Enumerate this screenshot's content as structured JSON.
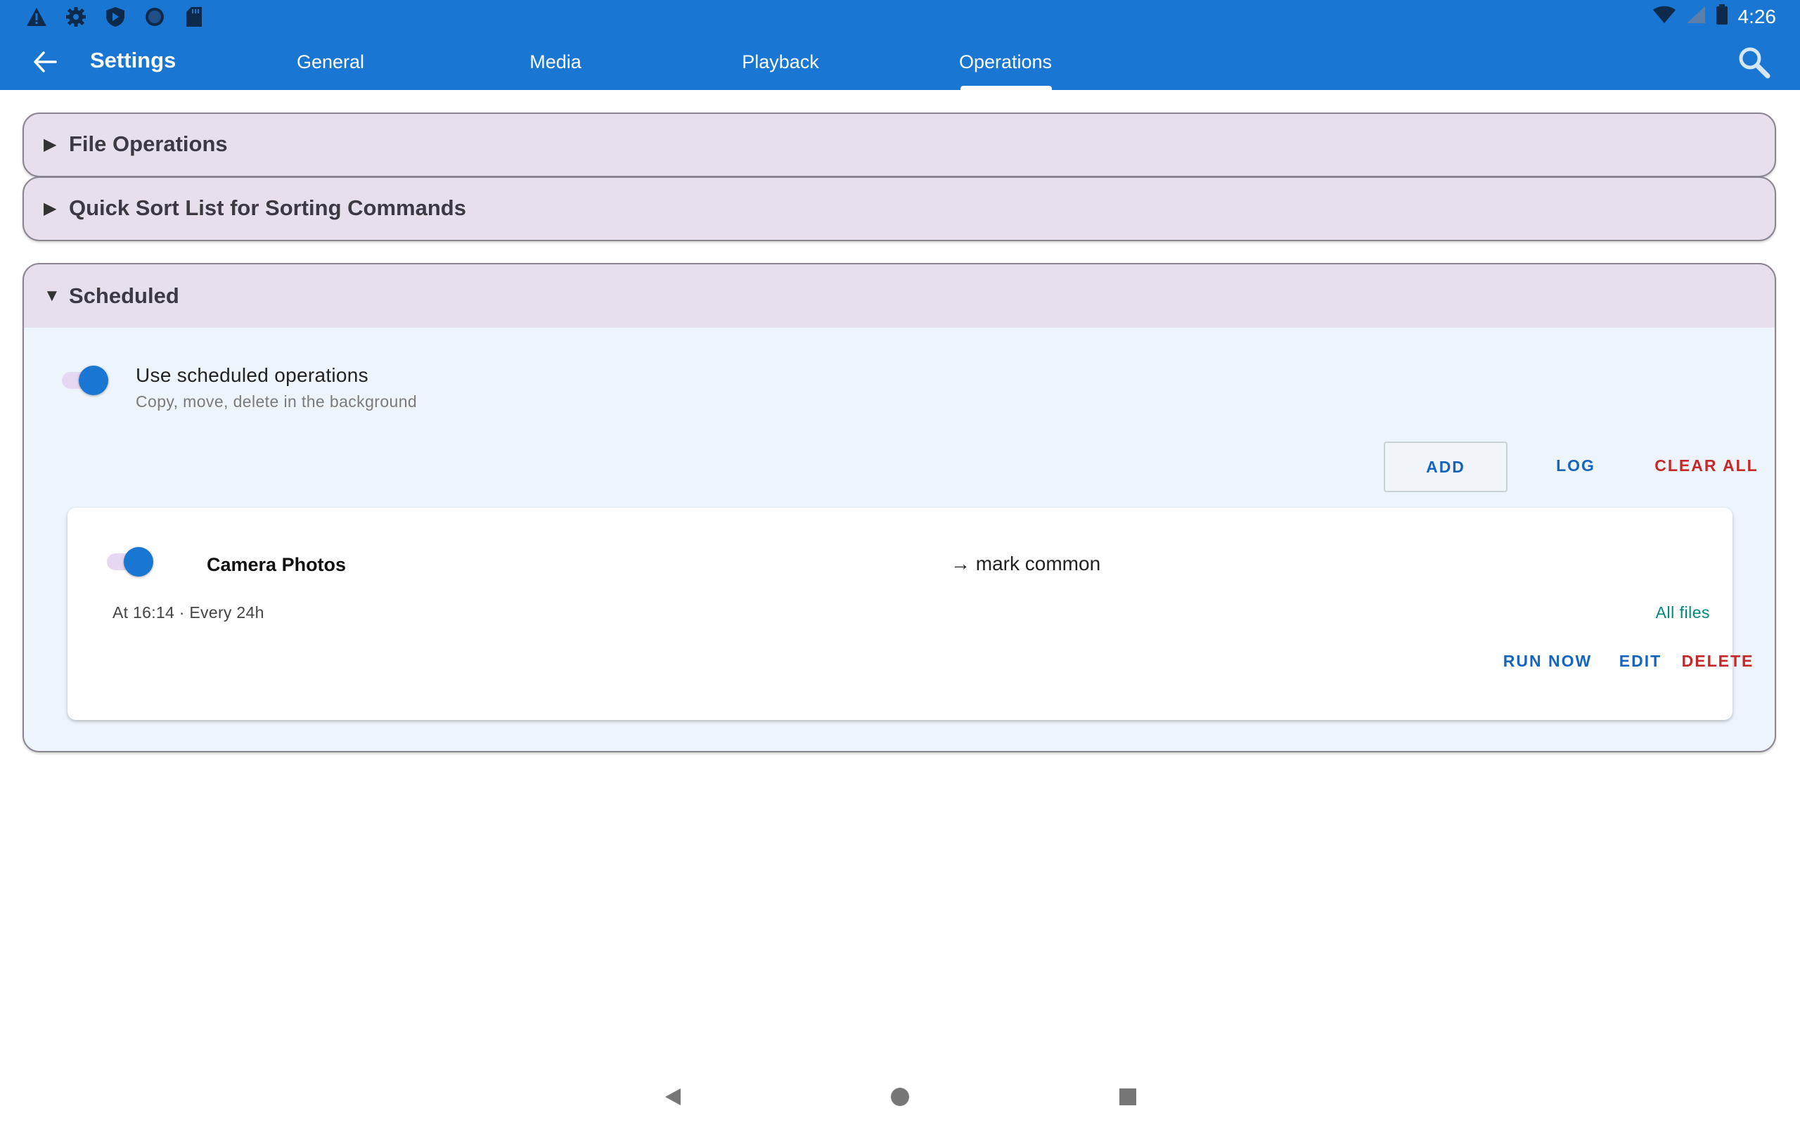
{
  "status_bar": {
    "time": "4:26",
    "left_icons": [
      "warning-icon",
      "gear-icon",
      "shield-icon",
      "circle-icon",
      "sd-card-icon"
    ],
    "right_icons": [
      "wifi-icon",
      "signal-icon",
      "battery-icon"
    ]
  },
  "appbar": {
    "title": "Settings",
    "back_icon": "arrow-left-icon",
    "search_icon": "search-icon",
    "tabs": [
      {
        "label": "General",
        "selected": false
      },
      {
        "label": "Media",
        "selected": false
      },
      {
        "label": "Playback",
        "selected": false
      },
      {
        "label": "Operations",
        "selected": true
      }
    ]
  },
  "sections": {
    "file_operations": {
      "title": "File Operations",
      "arrow": "▶",
      "expanded": false
    },
    "quick_sort": {
      "title": "Quick Sort List for Sorting Commands",
      "arrow": "▶",
      "expanded": false
    },
    "scheduled": {
      "title": "Scheduled",
      "arrow": "▼",
      "expanded": true,
      "use_scheduled": {
        "title": "Use scheduled operations",
        "subtitle": "Copy, move, delete in the background",
        "enabled": true
      },
      "actions": {
        "add": "ADD",
        "log": "LOG",
        "clear_all": "CLEAR ALL"
      },
      "job": {
        "enabled": true,
        "name": "Camera Photos",
        "target": "→ mark common",
        "schedule": "At 16:14 · Every 24h",
        "filter": "All files",
        "run_now": "RUN NOW",
        "edit": "EDIT",
        "delete": "DELETE"
      }
    }
  },
  "colors": {
    "primary": "#1976d2",
    "section_header": "#e8dfec",
    "section_body": "#eef4fb",
    "danger": "#c62828",
    "link": "#1565c0",
    "teal": "#00897b"
  },
  "navbar": {
    "icons": [
      "nav-back-icon",
      "nav-home-icon",
      "nav-recents-icon"
    ]
  }
}
